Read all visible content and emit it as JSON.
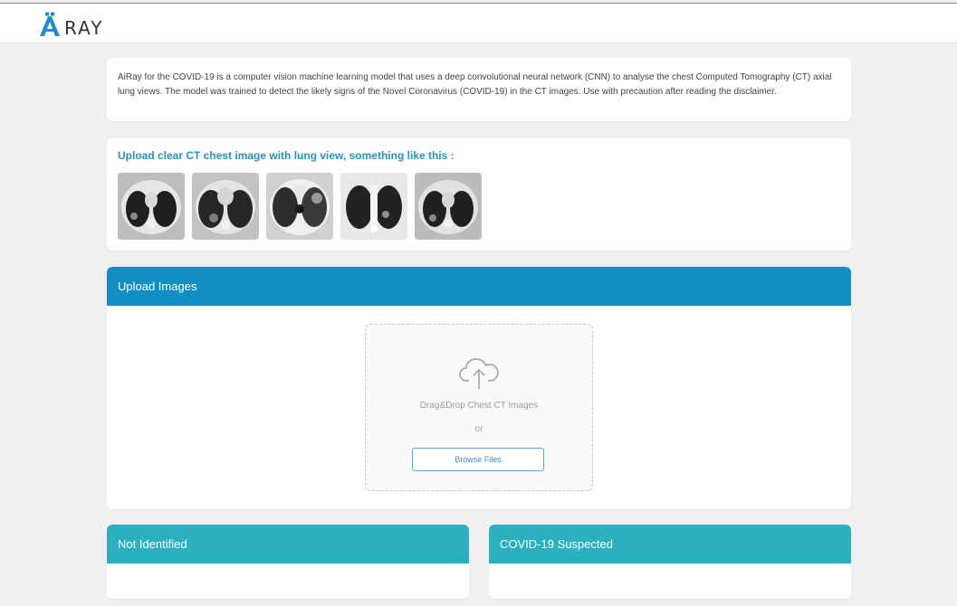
{
  "header": {
    "logo_text": "RAY"
  },
  "intro": {
    "text": "AiRay for the COVID-19 is a computer vision machine learning model that uses a deep convolutional neural network (CNN) to analyse the chest Computed Tomography (CT) axial lung views. The model was trained to detect the likely signs of the Novel Coronavirus (COVID-19) in the CT images. Use with precaution after reading the disclaimer."
  },
  "samples": {
    "heading": "Upload clear CT chest image with lung view, something like this :",
    "count": 5
  },
  "upload": {
    "title": "Upload Images",
    "drop_text": "Drag&Drop Chest CT Images",
    "or_text": "or",
    "browse_label": "Browse Files"
  },
  "results": {
    "not_identified": "Not Identified",
    "covid_suspected": "COVID-19 Suspected"
  },
  "colors": {
    "upload_header": "#118ec4",
    "result_header": "#2bb0bf",
    "heading_text": "#2b8fc0",
    "logo_blue": "#1b8fd0"
  }
}
